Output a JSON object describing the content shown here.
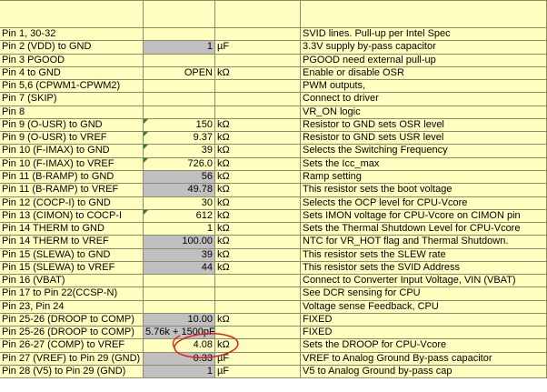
{
  "rows": [
    {
      "label": "",
      "value": "",
      "unit": "",
      "desc": ""
    },
    {
      "label": "Pin 1, 30-32",
      "value": "",
      "unit": "",
      "desc": "SVID lines. Pull-up per Intel Spec"
    },
    {
      "label": "Pin 2 (VDD) to GND",
      "value": "1",
      "unit": "µF",
      "desc": "3.3V supply by-pass capacitor",
      "grey": true
    },
    {
      "label": "Pin 3 PGOOD",
      "value": "",
      "unit": "",
      "desc": "PGOOD  need external pull-up"
    },
    {
      "label": "Pin 4 to GND",
      "value": "OPEN",
      "unit": "kΩ",
      "desc": "Enable or disable OSR"
    },
    {
      "label": "Pin 5,6 (CPWM1-CPWM2)",
      "value": "",
      "unit": "",
      "desc": "PWM outputs,"
    },
    {
      "label": "Pin 7 (SKIP)",
      "value": "",
      "unit": "",
      "desc": "Connect to driver"
    },
    {
      "label": "Pin 8",
      "value": "",
      "unit": "",
      "desc": "VR_ON logic"
    },
    {
      "label": "Pin 9 (O-USR) to GND",
      "value": "150",
      "unit": "kΩ",
      "desc": "Resistor to GND sets OSR level",
      "mark": true
    },
    {
      "label": "Pin 9 (O-USR) to VREF",
      "value": "9.37",
      "unit": "kΩ",
      "desc": "Resistor to GND sets USR level",
      "mark": true
    },
    {
      "label": "Pin 10 (F-IMAX) to GND",
      "value": "39",
      "unit": "kΩ",
      "desc": "Selects the Switching Frequency",
      "mark": true
    },
    {
      "label": "Pin 10 (F-IMAX) to VREF",
      "value": "726.0",
      "unit": "kΩ",
      "desc": "Sets the Icc_max",
      "mark": true
    },
    {
      "label": "Pin 11 (B-RAMP) to GND",
      "value": "56",
      "unit": "kΩ",
      "desc": "Ramp setting",
      "grey": true
    },
    {
      "label": "Pin 11 (B-RAMP) to VREF",
      "value": "49.78",
      "unit": "kΩ",
      "desc": "This resistor sets the boot voltage",
      "grey": true
    },
    {
      "label": "Pin 12 (COCP-I) to GND",
      "value": "30",
      "unit": "kΩ",
      "desc": "Selects the OCP level for CPU-Vcore"
    },
    {
      "label": "Pin 13 (CIMON) to COCP-I",
      "value": "612",
      "unit": "kΩ",
      "desc": "Sets IMON voltage for CPU-Vcore on CIMON pin",
      "mark": true
    },
    {
      "label": "Pin 14 THERM to GND",
      "value": "1",
      "unit": "kΩ",
      "desc": "Sets the Thermal Shutdown Level for CPU-Vcore"
    },
    {
      "label": "Pin 14 THERM to VREF",
      "value": "100.00",
      "unit": "kΩ",
      "desc": "NTC for VR_HOT flag and Thermal Shutdown.",
      "grey": true
    },
    {
      "label": "Pin 15 (SLEWA) to GND",
      "value": "39",
      "unit": "kΩ",
      "desc": "This resistor sets the SLEW rate",
      "grey": true
    },
    {
      "label": "Pin 15 (SLEWA) to VREF",
      "value": "44",
      "unit": "kΩ",
      "desc": "This resistor sets the SVID Address",
      "grey": true
    },
    {
      "label": "Pin 16 (VBAT)",
      "value": "",
      "unit": "",
      "desc": "Connect to Converter Input Voltage, VIN (VBAT)"
    },
    {
      "label": "Pin 17 to Pin 22(CCSP-N)",
      "value": "",
      "unit": "",
      "desc": "See DCR sensing for CPU"
    },
    {
      "label": "Pin 23, Pin 24",
      "value": "",
      "unit": "",
      "desc": "Voltage sense  Feedback, CPU"
    },
    {
      "label": "Pin 25-26 (DROOP to COMP)",
      "value": "10.00",
      "unit": "kΩ",
      "desc": "FIXED",
      "grey": true
    },
    {
      "label": "Pin 25-26 (DROOP to COMP)",
      "value": "5.76k + 1500pF",
      "unit": "",
      "desc": "FIXED",
      "grey": true
    },
    {
      "label": "Pin 26-27 (COMP) to VREF",
      "value": "4.08",
      "unit": "kΩ",
      "desc": "Sets the DROOP for CPU-Vcore"
    },
    {
      "label": "Pin 27 (VREF) to Pin 29 (GND)",
      "value": "0.33",
      "unit": "µF",
      "desc": "VREF to Analog Ground By-pass capacitor",
      "grey": true
    },
    {
      "label": "Pin 28 (V5) to Pin 29 (GND)",
      "value": "1",
      "unit": "µF",
      "desc": "V5 to Analog Ground by-pass cap",
      "grey": true
    }
  ],
  "colors": {
    "cell": "#ffffc0",
    "grey_cell": "#c0c0c0",
    "grid": "#8c8c6a",
    "comment_marker": "#2e7d32",
    "annotation_circle": "#e02020"
  }
}
